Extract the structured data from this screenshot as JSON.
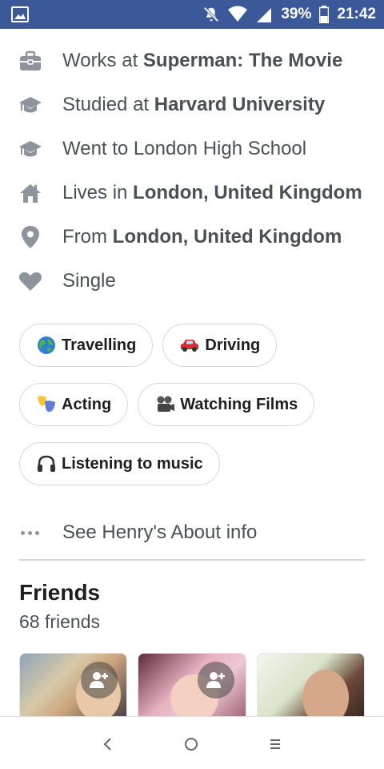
{
  "status_bar": {
    "battery": "39%",
    "time": "21:42",
    "icons": [
      "gallery-icon",
      "notifications-off-icon",
      "wifi-icon",
      "signal-icon",
      "battery-icon"
    ]
  },
  "info": [
    {
      "icon": "briefcase-icon",
      "prefix": "Works at ",
      "bold": "Superman: The Movie"
    },
    {
      "icon": "graduation-cap-icon",
      "prefix": "Studied at ",
      "bold": "Harvard University"
    },
    {
      "icon": "graduation-cap-icon",
      "prefix": "Went to London High School",
      "bold": ""
    },
    {
      "icon": "house-icon",
      "prefix": "Lives in ",
      "bold": "London, United Kingdom"
    },
    {
      "icon": "location-pin-icon",
      "prefix": "From ",
      "bold": "London, United Kingdom"
    },
    {
      "icon": "heart-icon",
      "prefix": "Single",
      "bold": ""
    }
  ],
  "interests": [
    {
      "label": "Travelling",
      "emoji": "🌏"
    },
    {
      "label": "Driving",
      "emoji": "🚘"
    },
    {
      "label": "Acting",
      "emoji": "🎭"
    },
    {
      "label": "Watching Films",
      "emoji": "📽"
    },
    {
      "label": "Listening to music",
      "emoji": "🎧"
    }
  ],
  "see_about": "See Henry's About info",
  "friends": {
    "title": "Friends",
    "count": "68 friends"
  },
  "colors": {
    "status_bar": "#3b5998",
    "icon_gray": "#8d949e",
    "text_secondary": "#4b4f56"
  }
}
